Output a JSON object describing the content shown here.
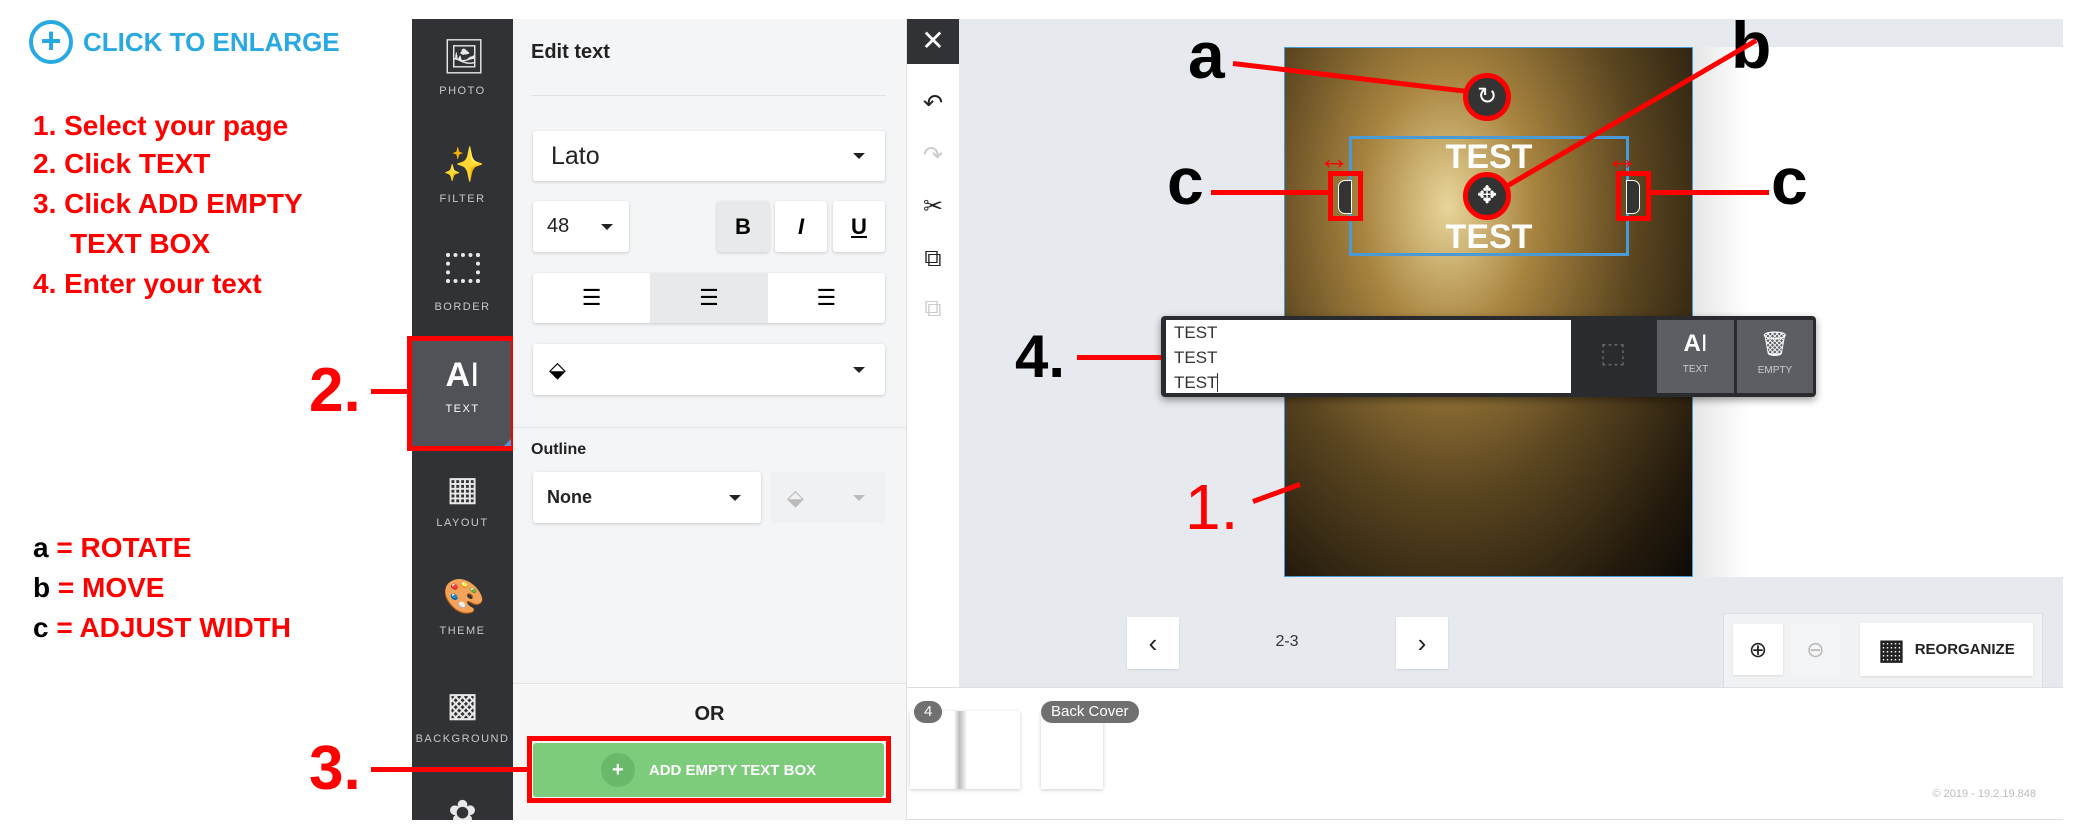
{
  "guide": {
    "enlarge_label": "CLICK TO ENLARGE",
    "accent": "#29a9e1",
    "steps": [
      "1. Select your page",
      "2. Click TEXT",
      "3. Click ADD EMPTY",
      "    TEXT BOX",
      "4. Enter your text"
    ],
    "legend": [
      {
        "key": "a",
        "value": "= ROTATE"
      },
      {
        "key": "b",
        "value": "= MOVE"
      },
      {
        "key": "c",
        "value": "= ADJUST WIDTH"
      }
    ],
    "markers": {
      "step1": "1.",
      "step2": "2.",
      "step3": "3.",
      "step4": "4.",
      "a": "a",
      "b": "b",
      "c": "c"
    }
  },
  "sidebar": {
    "items": [
      {
        "label": "PHOTO",
        "icon": "photo-icon"
      },
      {
        "label": "FILTER",
        "icon": "magic-wand-icon"
      },
      {
        "label": "BORDER",
        "icon": "border-icon"
      },
      {
        "label": "TEXT",
        "icon": "text-icon",
        "active": true
      },
      {
        "label": "LAYOUT",
        "icon": "layout-icon"
      },
      {
        "label": "THEME",
        "icon": "palette-icon"
      },
      {
        "label": "BACKGROUND",
        "icon": "background-icon"
      }
    ]
  },
  "panel": {
    "title": "Edit text",
    "font": "Lato",
    "size": "48",
    "bold": "B",
    "italic": "I",
    "underline": "U",
    "outline_label": "Outline",
    "outline_value": "None",
    "or_label": "OR",
    "add_button": "ADD EMPTY TEXT BOX",
    "add_button_color": "#7ccc7c"
  },
  "editor": {
    "lines": [
      "TEST",
      "TEST",
      "TEST"
    ],
    "text_button": "TEXT",
    "empty_button": "EMPTY",
    "canvas_text_top": "TEST",
    "canvas_text_bottom": "TEST"
  },
  "nav": {
    "pages": "2-3",
    "reorganize": "REORGANIZE"
  },
  "filmstrip": {
    "badge_page": "4",
    "badge_back": "Back Cover"
  },
  "footer": {
    "copyright": "© 2019 - 19.2.19.848"
  }
}
